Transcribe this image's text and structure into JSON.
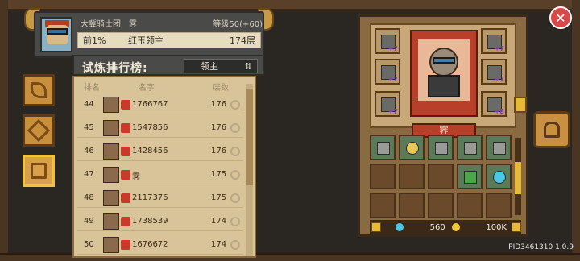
{
  "header": {
    "guild": "大冀骑士团",
    "player_name": "霁",
    "level": "等级50(+60)",
    "rank_percent": "前1%",
    "boss_title": "红玉领主",
    "floors": "174层"
  },
  "leaderboard": {
    "title": "试炼排行榜:",
    "select_value": "领主",
    "col_rank": "排名",
    "col_name": "名字",
    "col_floors": "层数",
    "rows": [
      {
        "rank": "44",
        "name": "1766767",
        "floors": "176"
      },
      {
        "rank": "45",
        "name": "1547856",
        "floors": "176"
      },
      {
        "rank": "46",
        "name": "1428456",
        "floors": "176"
      },
      {
        "rank": "47",
        "name": "霁",
        "floors": "175"
      },
      {
        "rank": "48",
        "name": "2117376",
        "floors": "175"
      },
      {
        "rank": "49",
        "name": "1738539",
        "floors": "174"
      },
      {
        "rank": "50",
        "name": "1676672",
        "floors": "174"
      }
    ]
  },
  "equipment": {
    "char_name": "霁",
    "slots": [
      {
        "lvl": "+7"
      },
      {
        "lvl": "+7"
      },
      {
        "lvl": "+7"
      },
      {
        "lvl": "+7"
      },
      {
        "lvl": "+7"
      },
      {
        "lvl": "+8"
      }
    ]
  },
  "currency": {
    "gems": "560",
    "coins": "100K"
  },
  "footer": {
    "pid": "PID3461310 1.0.9"
  },
  "colors": {
    "panel_tan": "#d9c499",
    "wood": "#8a6a40",
    "accent_red": "#b8402a",
    "gold": "#e8b838"
  }
}
